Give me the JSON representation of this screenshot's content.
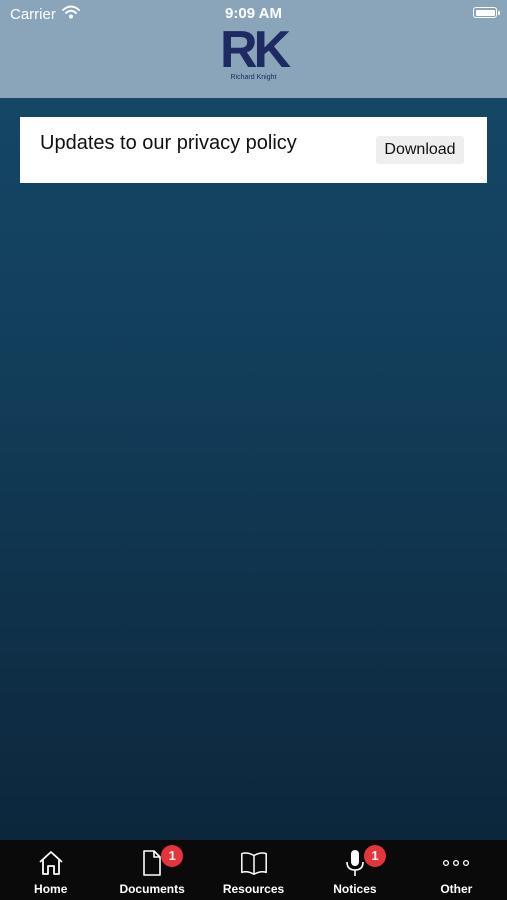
{
  "status_bar": {
    "carrier": "Carrier",
    "time": "9:09 AM"
  },
  "header": {
    "logo_mark": "RK",
    "logo_text": "Richard Knight"
  },
  "card": {
    "title": "Updates to our privacy policy",
    "button_label": "Download"
  },
  "tabs": [
    {
      "label": "Home",
      "icon": "home-icon",
      "badge": null
    },
    {
      "label": "Documents",
      "icon": "document-icon",
      "badge": "1"
    },
    {
      "label": "Resources",
      "icon": "book-icon",
      "badge": null
    },
    {
      "label": "Notices",
      "icon": "microphone-icon",
      "badge": "1"
    },
    {
      "label": "Other",
      "icon": "more-icon",
      "badge": null
    }
  ],
  "colors": {
    "header_bg": "#8aa5b9",
    "brand": "#1e2b63",
    "badge": "#e5353b",
    "tab_bar_bg": "#0a0a0a"
  }
}
